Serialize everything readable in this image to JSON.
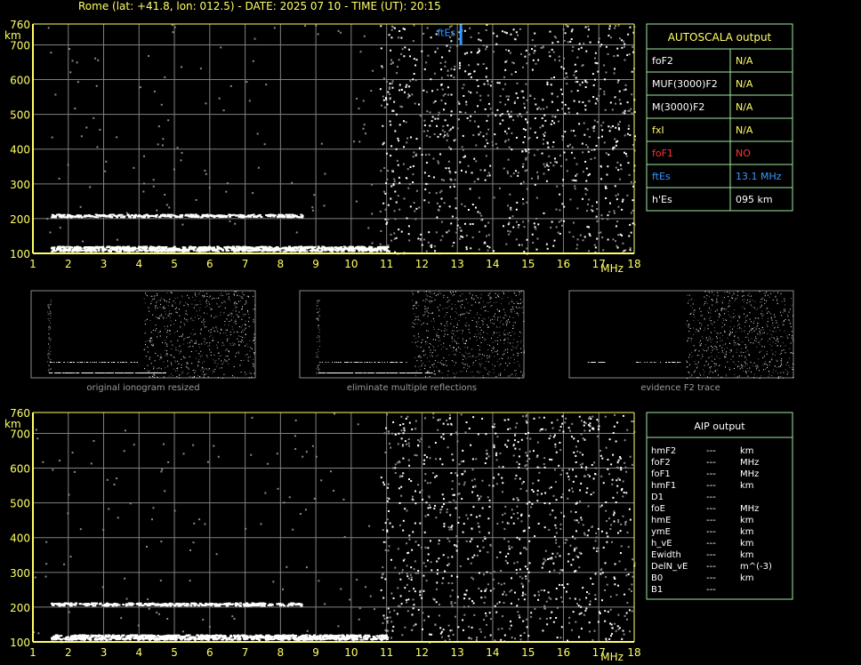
{
  "header": {
    "title": "Rome (lat: +41.8, lon: 012.5) - DATE: 2025 07 10 - TIME (UT): 20:15"
  },
  "colors": {
    "axis": "#ffff66",
    "grid": "#808080",
    "panel_border": "#9fe89f",
    "echo": "#ffffff",
    "fes_trace": "#3399ff",
    "status_no": "#ff3333"
  },
  "chart_data": [
    {
      "type": "scatter",
      "name": "top-ionogram",
      "xunit": "MHz",
      "yunit": "km",
      "xlim": [
        1,
        18
      ],
      "ylim": [
        100,
        760
      ],
      "xticks": [
        1,
        2,
        3,
        4,
        5,
        6,
        7,
        8,
        9,
        10,
        11,
        12,
        13,
        14,
        15,
        16,
        17,
        18
      ],
      "yticks": [
        100,
        200,
        300,
        400,
        500,
        600,
        700,
        760
      ],
      "grid": true,
      "traces": [
        {
          "f_start": 1.5,
          "f_end": 11.0,
          "h": 115
        },
        {
          "f_start": 1.5,
          "f_end": 8.6,
          "h": 210
        }
      ],
      "noise_from_mhz": 10.8,
      "annotation": {
        "label": "ftEs",
        "f": 13.1,
        "h_range": [
          700,
          760
        ],
        "color": "#3399ff"
      }
    },
    {
      "type": "scatter",
      "name": "bottom-ionogram",
      "xunit": "MHz",
      "yunit": "km",
      "xlim": [
        1,
        18
      ],
      "ylim": [
        100,
        760
      ],
      "xticks": [
        1,
        2,
        3,
        4,
        5,
        6,
        7,
        8,
        9,
        10,
        11,
        12,
        13,
        14,
        15,
        16,
        17,
        18
      ],
      "yticks": [
        100,
        200,
        300,
        400,
        500,
        600,
        700,
        760
      ],
      "grid": true,
      "traces": [
        {
          "f_start": 1.5,
          "f_end": 11.0,
          "h": 115
        },
        {
          "f_start": 1.5,
          "f_end": 8.6,
          "h": 210
        }
      ],
      "noise_from_mhz": 10.8
    }
  ],
  "thumbnails": [
    {
      "caption": "original ionogram resized"
    },
    {
      "caption": "eliminate multiple reflections"
    },
    {
      "caption": "evidence F2 trace"
    }
  ],
  "autoscala": {
    "title": "AUTOSCALA output",
    "rows": [
      {
        "param": "foF2",
        "value": "N/A",
        "param_color": "#ffffff",
        "value_color": "#ffff66"
      },
      {
        "param": "MUF(3000)F2",
        "value": "N/A",
        "param_color": "#ffffff",
        "value_color": "#ffff66"
      },
      {
        "param": "M(3000)F2",
        "value": "N/A",
        "param_color": "#ffffff",
        "value_color": "#ffff66"
      },
      {
        "param": "fxI",
        "value": "N/A",
        "param_color": "#ffff66",
        "value_color": "#ffff66"
      },
      {
        "param": "foF1",
        "value": "NO",
        "param_color": "#ff3333",
        "value_color": "#ff3333"
      },
      {
        "param": "ftEs",
        "value": "13.1  MHz",
        "param_color": "#3399ff",
        "value_color": "#3399ff"
      },
      {
        "param": "h'Es",
        "value": "095     km",
        "param_color": "#ffffff",
        "value_color": "#ffffff"
      }
    ]
  },
  "aip": {
    "title": "AIP output",
    "rows": [
      {
        "param": "hmF2",
        "value": "---",
        "unit": "km"
      },
      {
        "param": "foF2",
        "value": "---",
        "unit": "MHz"
      },
      {
        "param": "foF1",
        "value": "---",
        "unit": "MHz"
      },
      {
        "param": "hmF1",
        "value": "---",
        "unit": "km"
      },
      {
        "param": "D1",
        "value": "---",
        "unit": ""
      },
      {
        "param": "foE",
        "value": "---",
        "unit": "MHz"
      },
      {
        "param": "hmE",
        "value": "---",
        "unit": "km"
      },
      {
        "param": "ymE",
        "value": "---",
        "unit": "km"
      },
      {
        "param": "h_vE",
        "value": "---",
        "unit": "km"
      },
      {
        "param": "Ewidth",
        "value": "---",
        "unit": "km"
      },
      {
        "param": "DelN_vE",
        "value": "---",
        "unit": "m^(-3)"
      },
      {
        "param": "B0",
        "value": "---",
        "unit": "km"
      },
      {
        "param": "B1",
        "value": "---",
        "unit": ""
      }
    ]
  }
}
